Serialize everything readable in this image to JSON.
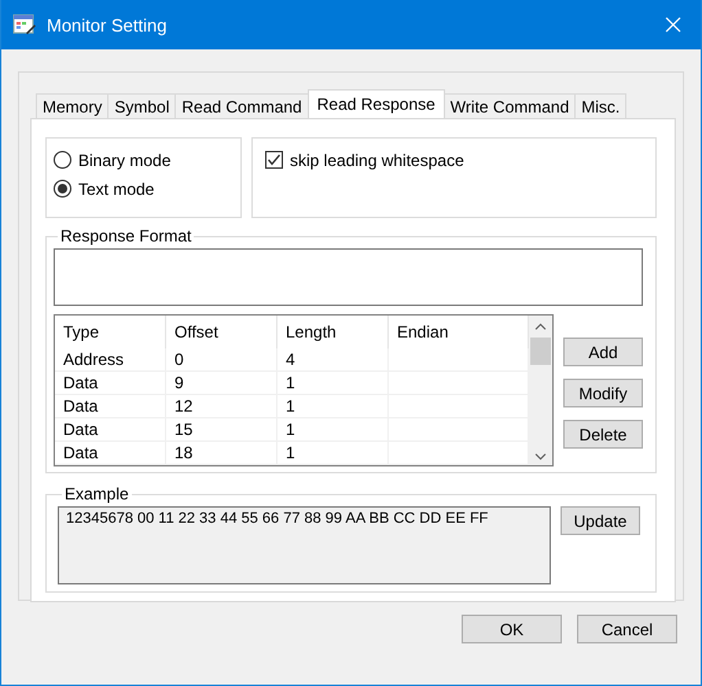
{
  "window": {
    "title": "Monitor Setting"
  },
  "tabs": [
    {
      "label": "Memory",
      "selected": false
    },
    {
      "label": "Symbol",
      "selected": false
    },
    {
      "label": "Read Command",
      "selected": false
    },
    {
      "label": "Read Response",
      "selected": true
    },
    {
      "label": "Write Command",
      "selected": false
    },
    {
      "label": "Misc.",
      "selected": false
    }
  ],
  "modes": [
    {
      "label": "Binary mode",
      "selected": false
    },
    {
      "label": "Text mode",
      "selected": true
    }
  ],
  "skip_whitespace": {
    "label": "skip leading whitespace",
    "checked": true
  },
  "response_format": {
    "title": "Response Format",
    "columns": [
      "Type",
      "Offset",
      "Length",
      "Endian"
    ],
    "rows": [
      [
        "Address",
        "0",
        "4",
        ""
      ],
      [
        "Data",
        "9",
        "1",
        ""
      ],
      [
        "Data",
        "12",
        "1",
        ""
      ],
      [
        "Data",
        "15",
        "1",
        ""
      ],
      [
        "Data",
        "18",
        "1",
        ""
      ]
    ],
    "buttons": [
      "Add",
      "Modify",
      "Delete"
    ]
  },
  "example": {
    "title": "Example",
    "text": "12345678 00 11 22 33 44 55 66 77 88 99 AA BB CC DD EE FF",
    "button": "Update"
  },
  "buttons": [
    "OK",
    "Cancel"
  ]
}
